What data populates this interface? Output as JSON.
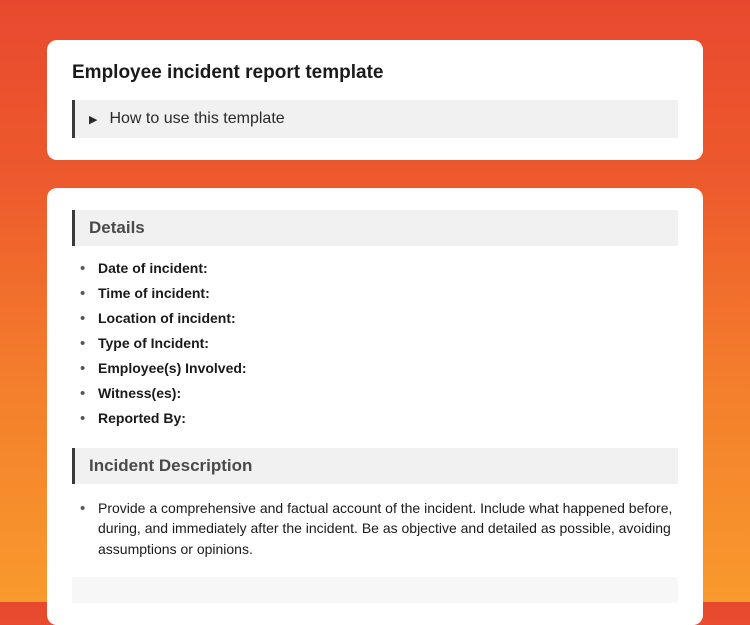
{
  "header": {
    "title": "Employee incident report template",
    "howToUse": "How to use this template"
  },
  "details": {
    "heading": "Details",
    "items": [
      "Date of incident:",
      "Time of incident:",
      "Location of incident:",
      "Type of Incident:",
      "Employee(s) Involved:",
      "Witness(es):",
      "Reported By:"
    ]
  },
  "incidentDescription": {
    "heading": "Incident Description",
    "body": "Provide a comprehensive and factual account of the incident. Include what happened before, during, and immediately after the incident. Be as objective and detailed as possible, avoiding assumptions or opinions."
  }
}
